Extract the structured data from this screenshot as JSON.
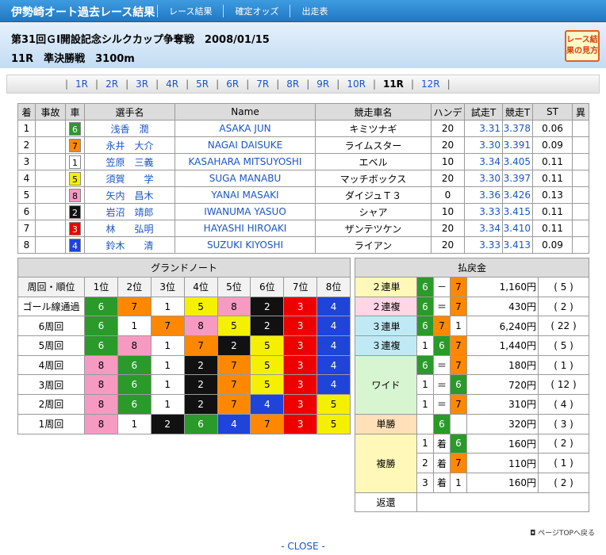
{
  "site": {
    "title": "伊勢崎オート過去レース結果",
    "nav": [
      "レース結果",
      "確定オッズ",
      "出走表"
    ]
  },
  "race": {
    "title": "第31回ＧⅠ開設記念シルクカップ争奪戦　2008/01/15",
    "sub": "11R　準決勝戦　3100m",
    "guide": "レース結果の見方"
  },
  "tabs": [
    "1R",
    "2R",
    "3R",
    "4R",
    "5R",
    "6R",
    "7R",
    "8R",
    "9R",
    "10R",
    "11R",
    "12R"
  ],
  "current_tab": "11R",
  "results": {
    "headers": [
      "着",
      "事故",
      "車",
      "選手名",
      "Name",
      "競走車名",
      "ハンデ",
      "試走T",
      "競走T",
      "ST",
      "異"
    ],
    "rows": [
      {
        "rank": "1",
        "car": "6",
        "name": "浅香　潤",
        "romaji": "ASAKA JUN",
        "machine": "キミツナギ",
        "handi": "20",
        "trial": "3.31",
        "race": "3.378",
        "st": "0.06"
      },
      {
        "rank": "2",
        "car": "7",
        "name": "永井　大介",
        "romaji": "NAGAI DAISUKE",
        "machine": "ライムスター",
        "handi": "20",
        "trial": "3.30",
        "race": "3.391",
        "st": "0.09"
      },
      {
        "rank": "3",
        "car": "1",
        "name": "笠原　三義",
        "romaji": "KASAHARA MITSUYOSHI",
        "machine": "エベル",
        "handi": "10",
        "trial": "3.34",
        "race": "3.405",
        "st": "0.11"
      },
      {
        "rank": "4",
        "car": "5",
        "name": "須賀　　学",
        "romaji": "SUGA MANABU",
        "machine": "マッチボックス",
        "handi": "20",
        "trial": "3.30",
        "race": "3.397",
        "st": "0.11"
      },
      {
        "rank": "5",
        "car": "8",
        "name": "矢内　昌木",
        "romaji": "YANAI MASAKI",
        "machine": "ダイジュＴ３",
        "handi": "0",
        "trial": "3.36",
        "race": "3.426",
        "st": "0.13"
      },
      {
        "rank": "6",
        "car": "2",
        "name": "岩沼　靖郎",
        "romaji": "IWANUMA YASUO",
        "machine": "シャア",
        "handi": "10",
        "trial": "3.33",
        "race": "3.415",
        "st": "0.11"
      },
      {
        "rank": "7",
        "car": "3",
        "name": "林　　弘明",
        "romaji": "HAYASHI HIROAKI",
        "machine": "ザンテツケン",
        "handi": "20",
        "trial": "3.34",
        "race": "3.410",
        "st": "0.11"
      },
      {
        "rank": "8",
        "car": "4",
        "name": "鈴木　　清",
        "romaji": "SUZUKI KIYOSHI",
        "machine": "ライアン",
        "handi": "20",
        "trial": "3.33",
        "race": "3.413",
        "st": "0.09"
      }
    ]
  },
  "grand": {
    "title": "グランドノート",
    "headers": [
      "周回・順位",
      "1位",
      "2位",
      "3位",
      "4位",
      "5位",
      "6位",
      "7位",
      "8位"
    ],
    "rows": [
      {
        "lap": "ゴール線通過",
        "cars": [
          "6",
          "7",
          "1",
          "5",
          "8",
          "2",
          "3",
          "4"
        ]
      },
      {
        "lap": "6周回",
        "cars": [
          "6",
          "1",
          "7",
          "8",
          "5",
          "2",
          "3",
          "4"
        ]
      },
      {
        "lap": "5周回",
        "cars": [
          "6",
          "8",
          "1",
          "7",
          "2",
          "5",
          "3",
          "4"
        ]
      },
      {
        "lap": "4周回",
        "cars": [
          "8",
          "6",
          "1",
          "2",
          "7",
          "5",
          "3",
          "4"
        ]
      },
      {
        "lap": "3周回",
        "cars": [
          "8",
          "6",
          "1",
          "2",
          "7",
          "5",
          "3",
          "4"
        ]
      },
      {
        "lap": "2周回",
        "cars": [
          "8",
          "6",
          "1",
          "2",
          "7",
          "4",
          "3",
          "5"
        ]
      },
      {
        "lap": "1周回",
        "cars": [
          "8",
          "1",
          "2",
          "6",
          "4",
          "7",
          "3",
          "5"
        ]
      }
    ]
  },
  "payout": {
    "title": "払戻金",
    "nirentan": {
      "label": "２連単",
      "a": "6",
      "op": "－",
      "b": "7",
      "amount": "1,160円",
      "pop": "( 5 )"
    },
    "nirenfuku": {
      "label": "２連複",
      "a": "6",
      "op": "＝",
      "b": "7",
      "amount": "430円",
      "pop": "( 2 )"
    },
    "sanrentan": {
      "label": "３連単",
      "a": "6",
      "b": "7",
      "c": "1",
      "amount": "6,240円",
      "pop": "( 22 )"
    },
    "sanrenfuku": {
      "label": "３連複",
      "a": "1",
      "b": "6",
      "c": "7",
      "amount": "1,440円",
      "pop": "( 5 )"
    },
    "wide": {
      "label": "ワイド",
      "rows": [
        {
          "a": "6",
          "op": "＝",
          "b": "7",
          "amount": "180円",
          "pop": "( 1 )"
        },
        {
          "a": "1",
          "op": "＝",
          "b": "6",
          "amount": "720円",
          "pop": "( 12 )"
        },
        {
          "a": "1",
          "op": "＝",
          "b": "7",
          "amount": "310円",
          "pop": "( 4 )"
        }
      ]
    },
    "tansho": {
      "label": "単勝",
      "car": "6",
      "amount": "320円",
      "pop": "( 3 )"
    },
    "fukusho": {
      "label": "複勝",
      "unit": "着",
      "rows": [
        {
          "rank": "1",
          "car": "6",
          "amount": "160円",
          "pop": "( 2 )"
        },
        {
          "rank": "2",
          "car": "7",
          "amount": "110円",
          "pop": "( 1 )"
        },
        {
          "rank": "3",
          "car": "1",
          "amount": "160円",
          "pop": "( 2 )"
        }
      ]
    },
    "refund": {
      "label": "返還"
    }
  },
  "footer": {
    "pagetop": "ページTOPへ戻る",
    "close": "- CLOSE -"
  }
}
